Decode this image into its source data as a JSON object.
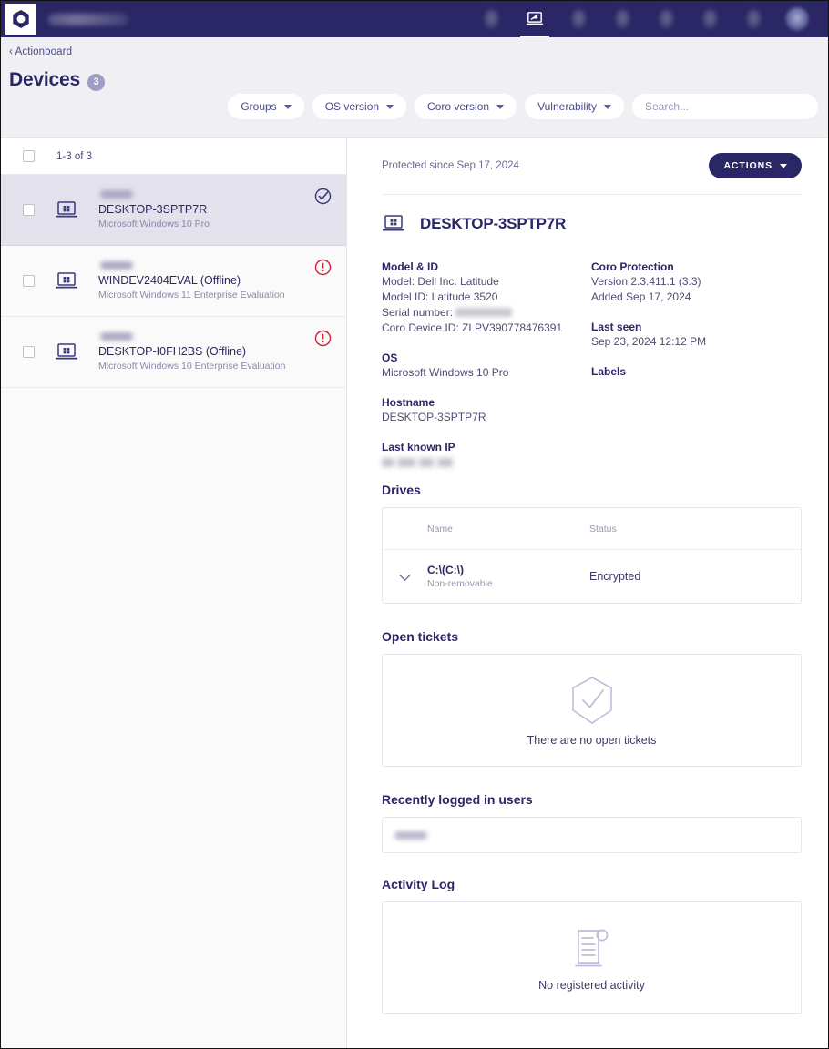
{
  "topnav": {
    "logo_icon": "coro-hexagon-logo",
    "brand_redacted": true,
    "items": [
      {
        "icon": "nav-blob-icon-1",
        "active": false
      },
      {
        "icon": "laptop-devices-icon",
        "active": true
      },
      {
        "icon": "nav-blob-icon-3",
        "active": false
      },
      {
        "icon": "nav-blob-icon-4",
        "active": false
      },
      {
        "icon": "nav-blob-icon-5",
        "active": false
      },
      {
        "icon": "nav-blob-icon-6",
        "active": false
      },
      {
        "icon": "nav-blob-icon-7",
        "active": false
      },
      {
        "icon": "user-avatar-icon",
        "active": false
      }
    ]
  },
  "header": {
    "breadcrumb": "‹ Actionboard",
    "title": "Devices",
    "count": "3"
  },
  "filters": {
    "groups": "Groups",
    "os_version": "OS version",
    "coro_version": "Coro version",
    "vulnerability": "Vulnerability",
    "search_placeholder": "Search...",
    "search_value": ""
  },
  "device_list": {
    "count_label": "1-3 of 3",
    "rows": [
      {
        "name": "DESKTOP-3SPTP7R",
        "os": "Microsoft Windows 10 Pro",
        "status_icon": "check-circle-icon",
        "status": "protected",
        "selected": true
      },
      {
        "name": "WINDEV2404EVAL (Offline)",
        "os": "Microsoft Windows 11 Enterprise Evaluation",
        "status_icon": "alert-circle-icon",
        "status": "alert",
        "selected": false
      },
      {
        "name": "DESKTOP-I0FH2BS (Offline)",
        "os": "Microsoft Windows 10 Enterprise Evaluation",
        "status_icon": "alert-circle-icon",
        "status": "alert",
        "selected": false
      }
    ]
  },
  "detail": {
    "protected_since": "Protected since Sep 17, 2024",
    "actions_label": "ACTIONS",
    "device_name": "DESKTOP-3SPTP7R",
    "device_icon": "laptop-icon",
    "model_id": {
      "label": "Model & ID",
      "model": "Model: Dell Inc. Latitude",
      "model_id": "Model ID: Latitude 3520",
      "serial_label": "Serial number:",
      "serial_value_redacted": true,
      "coro_device_id": "Coro Device ID: ZLPV390778476391"
    },
    "os": {
      "label": "OS",
      "value": "Microsoft Windows 10 Pro"
    },
    "hostname": {
      "label": "Hostname",
      "value": "DESKTOP-3SPTP7R"
    },
    "last_known_ip": {
      "label": "Last known IP",
      "value_redacted": true
    },
    "coro_protection": {
      "label": "Coro Protection",
      "version": "Version 2.3.411.1 (3.3)",
      "added": "Added Sep 17, 2024"
    },
    "last_seen": {
      "label": "Last seen",
      "value": "Sep 23, 2024 12:12 PM"
    },
    "labels": {
      "label": "Labels"
    },
    "drives": {
      "title": "Drives",
      "columns": [
        "Name",
        "Status"
      ],
      "rows": [
        {
          "name": "C:\\(C:\\)",
          "sub": "Non-removable",
          "status": "Encrypted",
          "expand_icon": "chevron-down-icon"
        }
      ]
    },
    "open_tickets": {
      "title": "Open tickets",
      "empty_text": "There are no open tickets",
      "empty_icon": "shield-check-icon"
    },
    "recent_users": {
      "title": "Recently logged in users",
      "value_redacted": true
    },
    "activity_log": {
      "title": "Activity Log",
      "empty_text": "No registered activity",
      "empty_icon": "scroll-document-icon"
    }
  },
  "colors": {
    "nav_bg": "#2B2766",
    "page_bg": "#EFEFF4",
    "accent": "#2B2766",
    "selected_row": "#E2E1EC",
    "alert_red": "#D0202F",
    "muted_text": "#8A89A8"
  }
}
